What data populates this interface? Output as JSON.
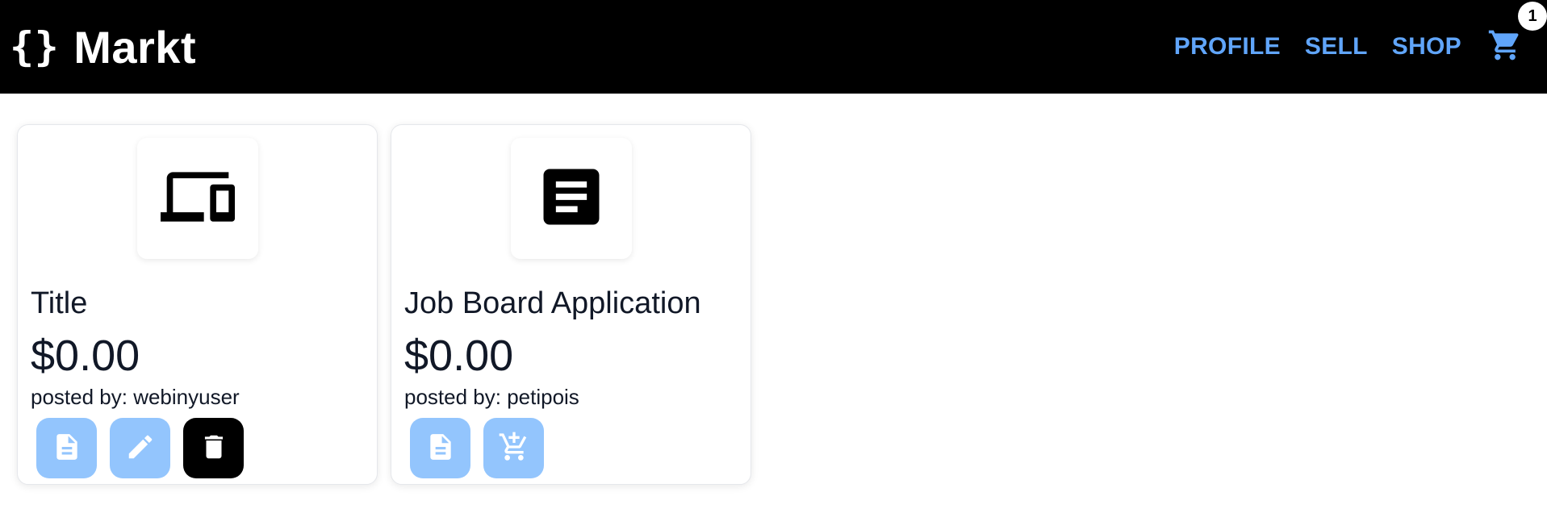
{
  "header": {
    "brand_braces": "{}",
    "brand_name": "Markt",
    "nav": [
      {
        "label": "PROFILE"
      },
      {
        "label": "SELL"
      },
      {
        "label": "SHOP"
      }
    ],
    "cart_count": "1"
  },
  "listings": [
    {
      "icon": "devices-icon",
      "title": "Title",
      "price": "$0.00",
      "posted_by": "posted by: webinyuser",
      "actions": [
        "details",
        "edit",
        "delete"
      ]
    },
    {
      "icon": "article-icon",
      "title": "Job Board Application",
      "price": "$0.00",
      "posted_by": "posted by: petipois",
      "actions": [
        "details",
        "add-to-cart"
      ]
    }
  ],
  "colors": {
    "accent": "#60a5fa",
    "button_light": "#93c5fd",
    "header_bg": "#000000"
  }
}
